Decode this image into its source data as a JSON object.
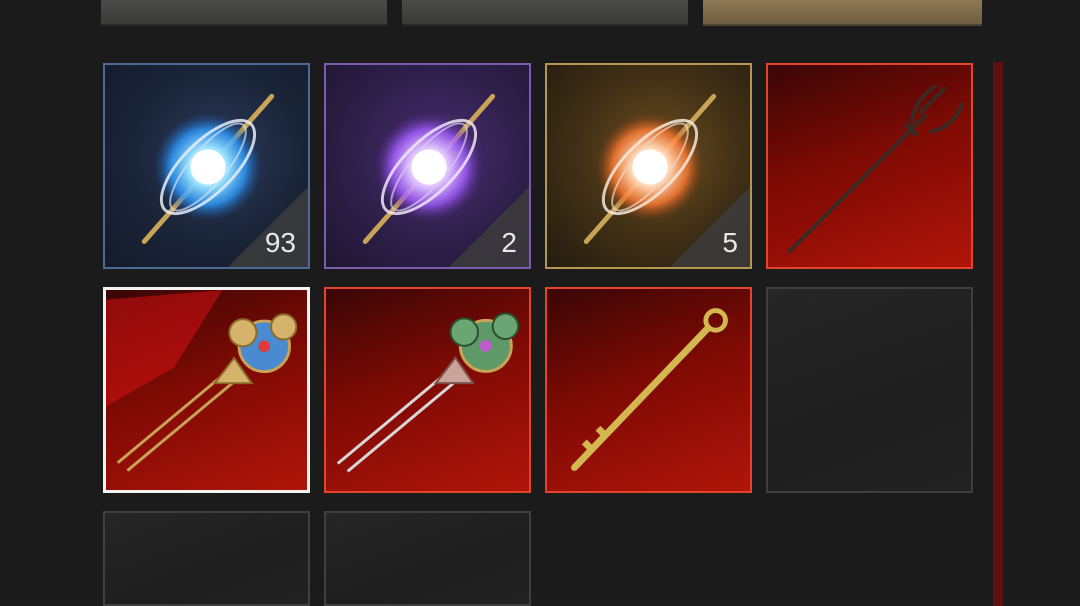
{
  "top_tabs": [
    {
      "name": "tab-1",
      "color": "#4a4a47"
    },
    {
      "name": "tab-2",
      "color": "#4a4a47"
    },
    {
      "name": "tab-3",
      "color": "#8f7a55"
    }
  ],
  "inventory": {
    "slots": [
      {
        "item": "blue-orb-arrow-icon",
        "rarity": "blue",
        "count": "93"
      },
      {
        "item": "purple-orb-arrow-icon",
        "rarity": "purple",
        "count": "2"
      },
      {
        "item": "gold-orb-arrow-icon",
        "rarity": "gold",
        "count": "5"
      },
      {
        "item": "trident-icon",
        "rarity": "red"
      },
      {
        "item": "blue-flower-hairpin-icon",
        "rarity": "red",
        "selected": true
      },
      {
        "item": "green-flower-hairpin-icon",
        "rarity": "red"
      },
      {
        "item": "golden-key-icon",
        "rarity": "red"
      },
      {
        "item": "empty",
        "rarity": "none"
      },
      {
        "item": "empty",
        "rarity": "none"
      },
      {
        "item": "empty",
        "rarity": "none"
      }
    ]
  },
  "colors": {
    "rarity_blue": "#4c6a98",
    "rarity_purple": "#7d5bb0",
    "rarity_gold": "#b8964f",
    "rarity_red": "#e2442c",
    "selected_border": "#f3f3f3",
    "scrollbar": "#5e1010"
  }
}
